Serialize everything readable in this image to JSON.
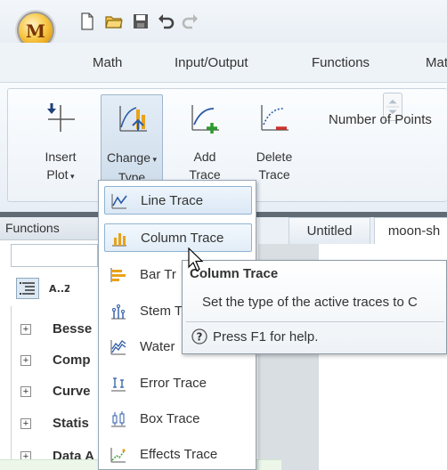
{
  "app": {
    "logo_letter": "M"
  },
  "ribbon_tabs": [
    "Math",
    "Input/Output",
    "Functions",
    "Mat"
  ],
  "ribbon": {
    "insert_plot": [
      "Insert",
      "Plot"
    ],
    "change_type": [
      "Change",
      "Type"
    ],
    "add_trace": [
      "Add",
      "Trace"
    ],
    "delete_trace": [
      "Delete",
      "Trace"
    ],
    "number_of_points": "Number of Points"
  },
  "functions_panel": {
    "header": "Functions",
    "categories": [
      "Besse",
      "Comp",
      "Curve",
      "Statis",
      "Data A"
    ]
  },
  "worksheet_tabs": [
    "Untitled",
    "moon-sh"
  ],
  "change_type_menu": {
    "items": [
      {
        "label": "Line Trace",
        "icon": "line-trace-icon",
        "state": "selected"
      },
      {
        "label": "Column Trace",
        "icon": "column-trace-icon",
        "state": "hover"
      },
      {
        "label": "Bar Tr",
        "icon": "bar-trace-icon",
        "state": "normal"
      },
      {
        "label": "Stem T",
        "icon": "stem-trace-icon",
        "state": "normal"
      },
      {
        "label": "Water",
        "icon": "waterfall-trace-icon",
        "state": "normal"
      },
      {
        "label": "Error Trace",
        "icon": "error-trace-icon",
        "state": "normal"
      },
      {
        "label": "Box Trace",
        "icon": "box-trace-icon",
        "state": "normal"
      },
      {
        "label": "Effects Trace",
        "icon": "effects-trace-icon",
        "state": "normal"
      }
    ]
  },
  "tooltip": {
    "title": "Column Trace",
    "description": "Set the type of the active traces to C",
    "help": "Press F1 for help."
  },
  "colors": {
    "accent_green": "#2e9a2e",
    "accent_red": "#d0302a",
    "menu_highlight": "#dbe8f5",
    "plot_blue": "#2b5aa8",
    "chart_orange": "#e8a21b"
  }
}
